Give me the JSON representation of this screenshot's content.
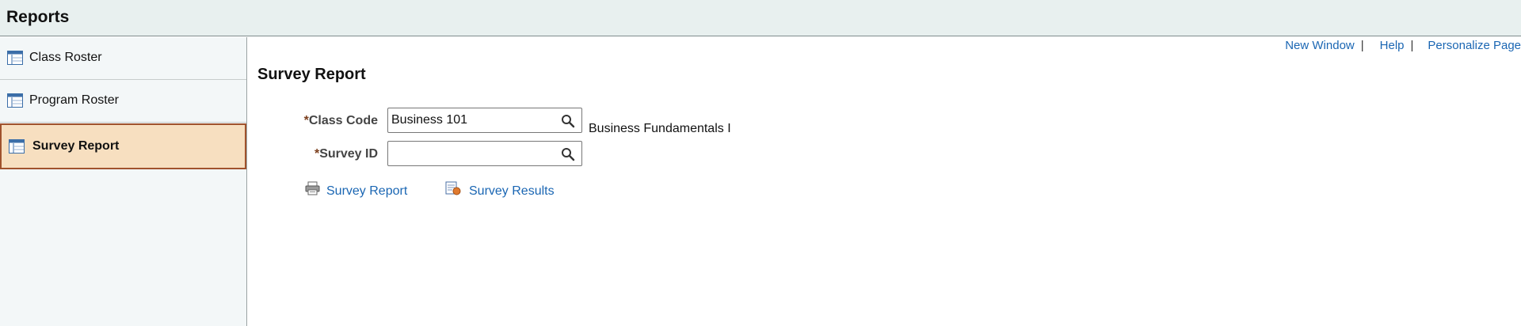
{
  "header": {
    "title": "Reports"
  },
  "sidebar": {
    "items": [
      {
        "label": "Class Roster",
        "icon": "report-icon",
        "selected": false
      },
      {
        "label": "Program Roster",
        "icon": "report-icon",
        "selected": false
      },
      {
        "label": "Survey Report",
        "icon": "report-icon",
        "selected": true
      }
    ]
  },
  "toplinks": {
    "new_window": "New Window",
    "help": "Help",
    "personalize": "Personalize Page",
    "separator": "|"
  },
  "main": {
    "title": "Survey Report",
    "class_code": {
      "label": "Class Code",
      "required_mark": "*",
      "value": "Business 101",
      "description": "Business Fundamentals I"
    },
    "survey_id": {
      "label": "Survey ID",
      "required_mark": "*",
      "value": ""
    },
    "links": {
      "survey_report": {
        "label": "Survey Report",
        "icon": "printer-icon"
      },
      "survey_results": {
        "label": "Survey Results",
        "icon": "results-report-icon"
      }
    }
  },
  "colors": {
    "header_bg": "#e8f0ef",
    "sidebar_bg": "#f3f7f8",
    "selected_bg": "#f7dfc0",
    "selected_border": "#a0522d",
    "link": "#1a66b3"
  }
}
